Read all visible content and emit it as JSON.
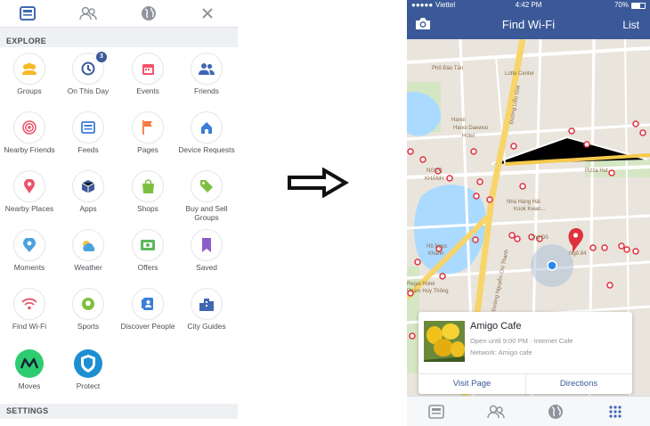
{
  "left_panel": {
    "top_icons": [
      "feed-icon",
      "friends-icon",
      "globe-icon",
      "close-icon"
    ],
    "explore_header": "EXPLORE",
    "settings_header": "SETTINGS",
    "tiles": [
      {
        "label": "Groups",
        "icon": "groups-icon",
        "color": "#f7b928"
      },
      {
        "label": "On This Day",
        "icon": "on-this-day-icon",
        "color": "#3b5998",
        "badge": "3"
      },
      {
        "label": "Events",
        "icon": "events-icon",
        "color": "#f35369"
      },
      {
        "label": "Friends",
        "icon": "friends-icon",
        "color": "#4267b2"
      },
      {
        "label": "Nearby Friends",
        "icon": "nearby-friends-icon",
        "color": "#e9546b"
      },
      {
        "label": "Feeds",
        "icon": "feeds-icon",
        "color": "#3b7dd8"
      },
      {
        "label": "Pages",
        "icon": "pages-icon",
        "color": "#f5793a"
      },
      {
        "label": "Device Requests",
        "icon": "device-requests-icon",
        "color": "#3b7dd8"
      },
      {
        "label": "Nearby Places",
        "icon": "nearby-places-icon",
        "color": "#e9546b"
      },
      {
        "label": "Apps",
        "icon": "apps-icon",
        "color": "#3b5998"
      },
      {
        "label": "Shops",
        "icon": "shops-icon",
        "color": "#7fbf3f"
      },
      {
        "label": "Buy and Sell Groups",
        "icon": "buy-sell-icon",
        "color": "#7fbf3f"
      },
      {
        "label": "Moments",
        "icon": "moments-icon",
        "color": "#4aa3df"
      },
      {
        "label": "Weather",
        "icon": "weather-icon",
        "color": "#4aa3df"
      },
      {
        "label": "Offers",
        "icon": "offers-icon",
        "color": "#5cb85c"
      },
      {
        "label": "Saved",
        "icon": "saved-icon",
        "color": "#8c5fc8"
      },
      {
        "label": "Find Wi-Fi",
        "icon": "wifi-icon",
        "color": "#e9546b"
      },
      {
        "label": "Sports",
        "icon": "sports-icon",
        "color": "#7fbf3f"
      },
      {
        "label": "Discover People",
        "icon": "discover-people-icon",
        "color": "#3b7dd8"
      },
      {
        "label": "City Guides",
        "icon": "city-guides-icon",
        "color": "#4267b2"
      },
      {
        "label": "Moves",
        "icon": "moves-icon",
        "color": "#2ecc71"
      },
      {
        "label": "Protect",
        "icon": "protect-icon",
        "color": "#1c8fd1"
      }
    ]
  },
  "phone": {
    "status": {
      "carrier": "Viettel",
      "time": "4:42 PM",
      "battery": "70%"
    },
    "nav": {
      "title": "Find Wi-Fi",
      "list_label": "List"
    },
    "map_labels": [
      "Phố Đào Tấn",
      "Lotte Center",
      "Hanoi",
      "Hanoi Daewoo",
      "Hotel",
      "Đường Liễu Giai",
      "NGỌC",
      "KHÁNH",
      "Pizza Hut",
      "Hồ Ngọc",
      "Khánh",
      "Nhà Hàng Hải",
      "Kook Kwan...",
      "Lồng Đồ",
      "Ngõ 84",
      "Regal Hotel",
      "Đường Nguyễn Chí Thanh",
      "Phạm Huy Thông"
    ],
    "card": {
      "title": "Amigo Cafe",
      "subtitle": "Open until 9:00 PM · Internet Cafe",
      "network": "Network: Amigo cafe",
      "visit_label": "Visit Page",
      "directions_label": "Directions"
    },
    "tabs": [
      "news-feed-icon",
      "friends-icon",
      "globe-icon",
      "menu-icon"
    ],
    "accent": "#3b5998",
    "pin_color": "#e0313e"
  }
}
